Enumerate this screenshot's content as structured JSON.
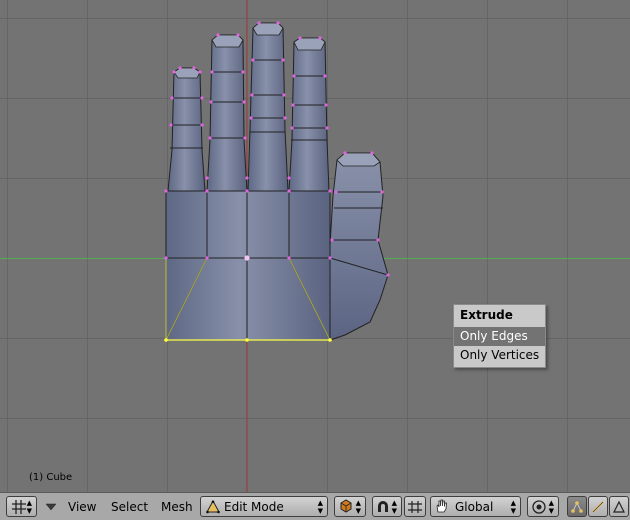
{
  "viewport": {
    "object_label": "(1) Cube"
  },
  "popup": {
    "title": "Extrude",
    "items": [
      "Only Edges",
      "Only Vertices"
    ],
    "highlighted_index": 0
  },
  "header": {
    "menus": [
      "View",
      "Select",
      "Mesh"
    ],
    "mode": "Edit Mode",
    "orientation": "Global"
  },
  "colors": {
    "background": "#737373",
    "grid": "#5a5a5a",
    "x_axis": "#55aa55",
    "y_axis": "#aa4444",
    "mesh_fill": "#6f7994",
    "vertex": "#e066e0",
    "selected": "#ffff44"
  },
  "icons": {
    "window_type": "grid-window-icon",
    "mode": "mesh-triangle-icon",
    "shading": "solid-cube-icon",
    "pivot": "magnet-icon",
    "manipulator": "hand-icon",
    "proportional": "circle-target-icon",
    "vertex_select": "vertex-select-icon",
    "edge_select": "edge-select-icon",
    "face_select": "face-select-icon"
  }
}
